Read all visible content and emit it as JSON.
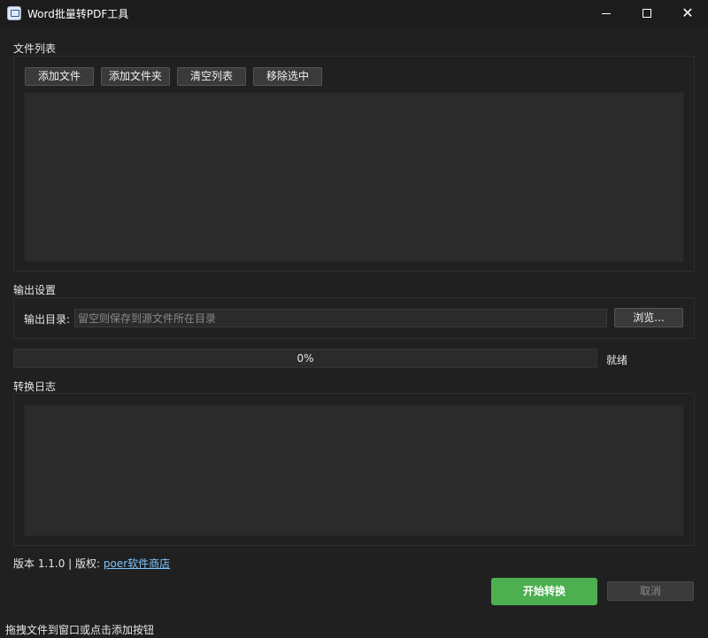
{
  "window": {
    "title": "Word批量转PDF工具",
    "minimize_icon": "minimize-icon",
    "maximize_icon": "maximize-icon",
    "close_icon": "close-icon",
    "close_glyph": "✕"
  },
  "file_list": {
    "section_title": "文件列表",
    "buttons": {
      "add_files": "添加文件",
      "add_folder": "添加文件夹",
      "clear_list": "清空列表",
      "remove_selected": "移除选中"
    },
    "items": []
  },
  "output": {
    "section_title": "输出设置",
    "dir_label": "输出目录:",
    "dir_value": "",
    "dir_placeholder": "留空则保存到源文件所在目录",
    "browse_label": "浏览..."
  },
  "progress": {
    "value": 0,
    "text": "0%",
    "status": "就绪"
  },
  "log": {
    "section_title": "转换日志",
    "entries": []
  },
  "footer": {
    "version_text": "版本 1.1.0 | 版权:",
    "copyright_link": "poer软件商店",
    "start_label": "开始转换",
    "cancel_label": "取消"
  },
  "statusbar": {
    "text": "拖拽文件到窗口或点击添加按钮"
  },
  "colors": {
    "background": "#202020",
    "panel": "#2b2b2b",
    "accent": "#4caf50",
    "link": "#7fc4ff"
  }
}
